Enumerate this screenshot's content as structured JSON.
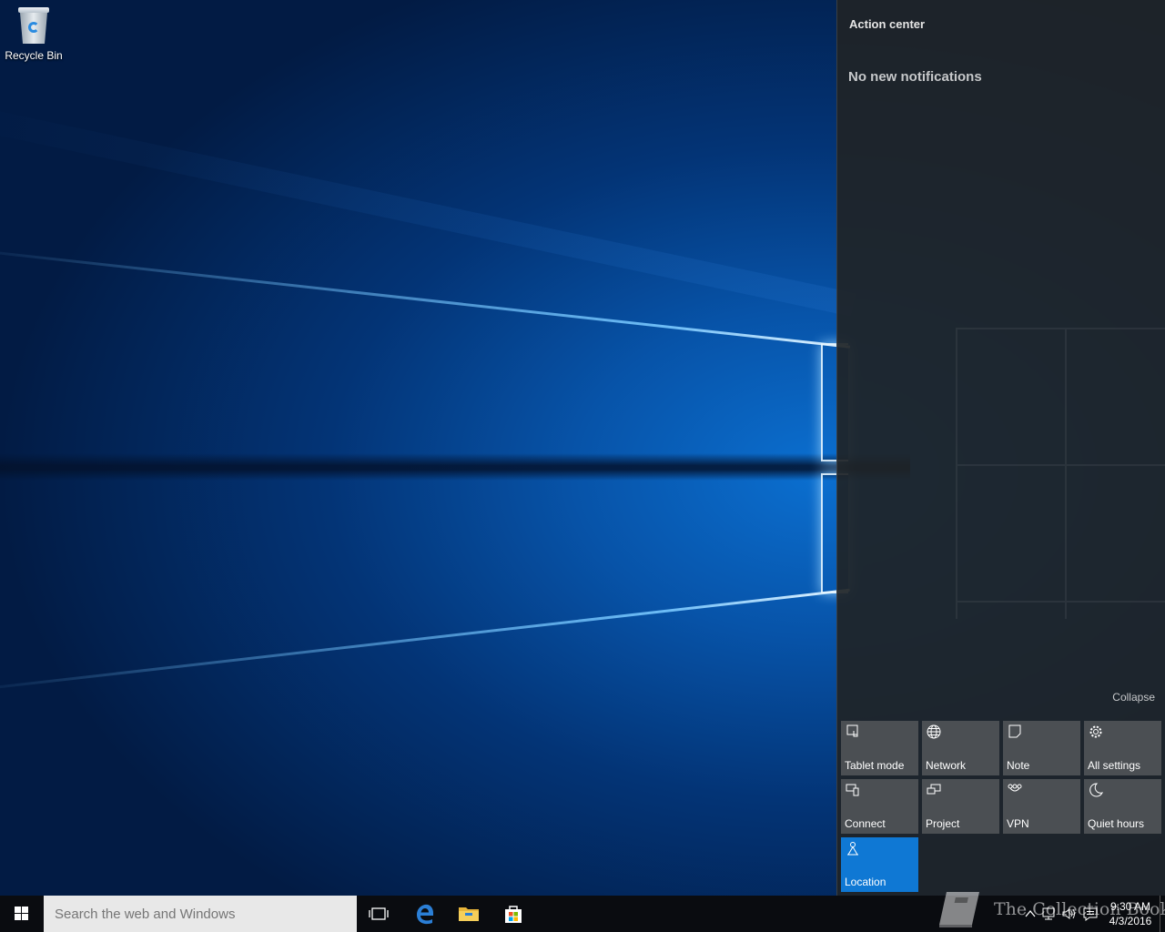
{
  "desktop": {
    "icons": [
      {
        "label": "Recycle Bin",
        "icon": "recycle-bin-icon"
      }
    ]
  },
  "action_center": {
    "title": "Action center",
    "empty_message": "No new notifications",
    "collapse_label": "Collapse",
    "accent": "#0f78d4",
    "tiles": [
      {
        "label": "Tablet mode",
        "icon": "tablet-mode-icon",
        "active": false
      },
      {
        "label": "Network",
        "icon": "network-globe-icon",
        "active": false
      },
      {
        "label": "Note",
        "icon": "note-icon",
        "active": false
      },
      {
        "label": "All settings",
        "icon": "gear-icon",
        "active": false
      },
      {
        "label": "Connect",
        "icon": "connect-icon",
        "active": false
      },
      {
        "label": "Project",
        "icon": "project-icon",
        "active": false
      },
      {
        "label": "VPN",
        "icon": "vpn-icon",
        "active": false
      },
      {
        "label": "Quiet hours",
        "icon": "moon-icon",
        "active": false
      },
      {
        "label": "Location",
        "icon": "location-icon",
        "active": true
      }
    ]
  },
  "taskbar": {
    "search_placeholder": "Search the web and Windows",
    "pinned": [
      {
        "name": "task-view",
        "icon": "task-view-icon"
      },
      {
        "name": "edge",
        "icon": "edge-browser-icon"
      },
      {
        "name": "file-explorer",
        "icon": "folder-icon"
      },
      {
        "name": "store",
        "icon": "store-bag-icon"
      }
    ],
    "tray": {
      "time": "9:30 AM",
      "date": "4/3/2016"
    }
  },
  "watermark": {
    "text": "The Collection Book"
  }
}
